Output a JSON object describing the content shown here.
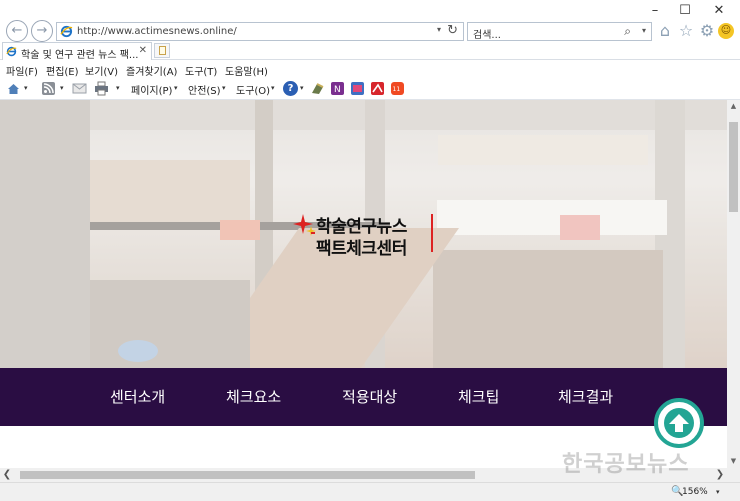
{
  "window": {
    "minimize_label": "–",
    "maximize_label": "☐",
    "close_label": "✕"
  },
  "address_bar": {
    "back_label": "←",
    "forward_label": "→",
    "url": "http://www.actimesnews.online/",
    "dropdown_label": "▾",
    "refresh_label": "↻"
  },
  "search_bar": {
    "placeholder": "검색...",
    "search_icon": "⌕",
    "dropdown_label": "▾"
  },
  "toolbar_icons": {
    "home": "⌂",
    "favorites": "☆",
    "tools": "⚙",
    "feedback": "☺"
  },
  "tab": {
    "title": "학술 및 연구 관련 뉴스 팩...",
    "close_label": "✕"
  },
  "menu": {
    "items": [
      "파일(F)",
      "편집(E)",
      "보기(V)",
      "즐겨찾기(A)",
      "도구(T)",
      "도움말(H)"
    ]
  },
  "command_bar": {
    "page": "페이지(P)",
    "safety": "안전(S)",
    "tools": "도구(O)",
    "arrow": "▾",
    "help": "?"
  },
  "site": {
    "logo_line1": "학술연구뉴스",
    "logo_line2": "팩트체크센터",
    "nav": [
      "센터소개",
      "체크요소",
      "적용대상",
      "체크팁",
      "체크결과"
    ],
    "top_button_label": "▲"
  },
  "scrollbars": {
    "up": "▲",
    "down": "▼",
    "left": "❮",
    "right": "❯"
  },
  "status_bar": {
    "zoom_icon": "🔍",
    "zoom": "156%",
    "zoom_dd": "▾"
  },
  "watermark": "한국공보뉴스",
  "colors": {
    "nav_background": "#2a0d43",
    "top_button": "#23a594",
    "logo_accent": "#dd2222"
  }
}
